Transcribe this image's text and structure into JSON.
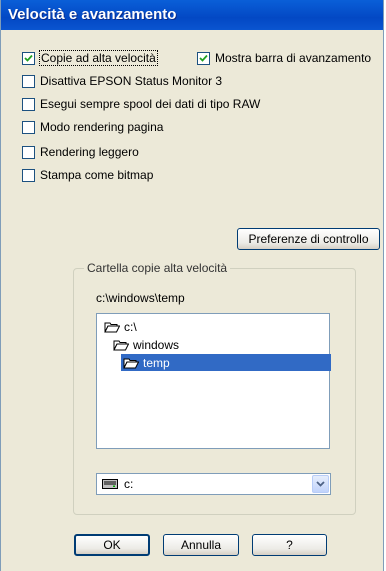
{
  "window": {
    "title": "Velocità e avanzamento"
  },
  "options": {
    "high_speed_copies": {
      "label": "Copie ad alta velocità",
      "checked": true
    },
    "show_progress_bar": {
      "label": "Mostra barra di avanzamento",
      "checked": true
    },
    "disable_status_monitor": {
      "label": "Disattiva EPSON Status Monitor 3",
      "checked": false
    },
    "always_spool_raw": {
      "label": "Esegui sempre spool dei dati di tipo RAW",
      "checked": false
    },
    "page_rendering_mode": {
      "label": "Modo rendering pagina",
      "checked": false
    },
    "light_rendering": {
      "label": "Rendering leggero",
      "checked": false
    },
    "print_as_bitmap": {
      "label": "Stampa come bitmap",
      "checked": false
    }
  },
  "monitoring_preferences_button": "Preferenze di controllo",
  "folder_group": {
    "label": "Cartella copie alta velocità",
    "current_path": "c:\\windows\\temp",
    "tree": [
      {
        "label": "c:\\",
        "icon": "folder-open-icon",
        "selected": false
      },
      {
        "label": "windows",
        "icon": "folder-open-icon",
        "selected": false
      },
      {
        "label": "temp",
        "icon": "folder-open-icon",
        "selected": true
      }
    ],
    "drive_select": {
      "value": "c:",
      "icon": "drive-icon"
    }
  },
  "buttons": {
    "ok": "OK",
    "cancel": "Annulla",
    "help": "?"
  }
}
